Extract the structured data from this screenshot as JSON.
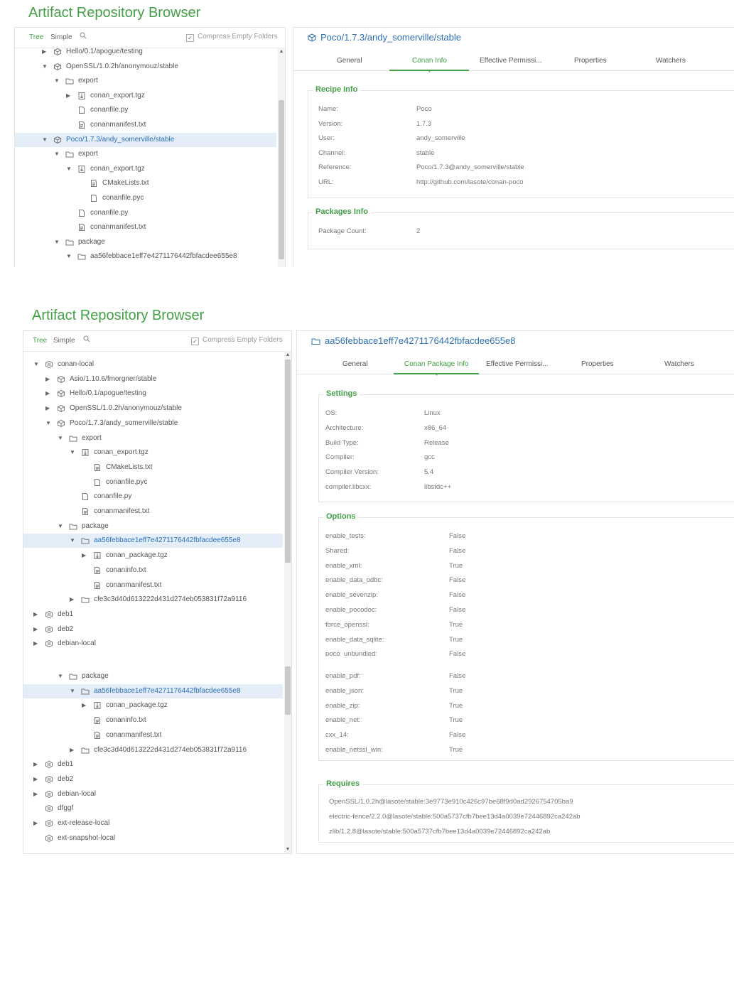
{
  "app_title": "Artifact Repository Browser",
  "tree_header": {
    "tree_tab": "Tree",
    "simple_tab": "Simple",
    "compress_label": "Compress Empty Folders"
  },
  "tabs_labels": [
    "General",
    "Conan Info",
    "Effective Permissi...",
    "Properties",
    "Watchers"
  ],
  "tabs_labels_pkg": [
    "General",
    "Conan Package Info",
    "Effective Permissi...",
    "Properties",
    "Watchers"
  ],
  "shot1": {
    "tree": [
      {
        "label": "Hello/0.1/apogue/testing",
        "icon": "package-icon",
        "indent": 0,
        "arrow": "right"
      },
      {
        "label": "OpenSSL/1.0.2h/anonymouz/stable",
        "icon": "package-icon",
        "indent": 0,
        "arrow": "down"
      },
      {
        "label": "export",
        "icon": "folder-icon",
        "indent": 1,
        "arrow": "down"
      },
      {
        "label": "conan_export.tgz",
        "icon": "archive-icon",
        "indent": 2,
        "arrow": "right"
      },
      {
        "label": "conanfile.py",
        "icon": "file-icon",
        "indent": 2,
        "arrow": ""
      },
      {
        "label": "conanmanifest.txt",
        "icon": "text-file-icon",
        "indent": 2,
        "arrow": ""
      },
      {
        "label": "Poco/1.7.3/andy_somerville/stable",
        "icon": "package-icon",
        "indent": 0,
        "arrow": "down",
        "selected": true
      },
      {
        "label": "export",
        "icon": "folder-icon",
        "indent": 1,
        "arrow": "down"
      },
      {
        "label": "conan_export.tgz",
        "icon": "archive-icon",
        "indent": 2,
        "arrow": "down"
      },
      {
        "label": "CMakeLists.txt",
        "icon": "text-file-icon",
        "indent": 3,
        "arrow": ""
      },
      {
        "label": "conanfile.pyc",
        "icon": "file-icon",
        "indent": 3,
        "arrow": ""
      },
      {
        "label": "conanfile.py",
        "icon": "file-icon",
        "indent": 2,
        "arrow": ""
      },
      {
        "label": "conanmanifest.txt",
        "icon": "text-file-icon",
        "indent": 2,
        "arrow": ""
      },
      {
        "label": "package",
        "icon": "folder-icon",
        "indent": 1,
        "arrow": "down"
      },
      {
        "label": "aa56febbace1eff7e4271176442fbfacdee655e8",
        "icon": "folder-icon",
        "indent": 2,
        "arrow": "down"
      }
    ],
    "right_title": "Poco/1.7.3/andy_somerville/stable",
    "recipe_title": "Recipe Info",
    "recipe": [
      {
        "key": "Name:",
        "value": "Poco"
      },
      {
        "key": "Version:",
        "value": "1.7.3"
      },
      {
        "key": "User:",
        "value": "andy_somerville"
      },
      {
        "key": "Channel:",
        "value": "stable"
      },
      {
        "key": "Reference:",
        "value": "Poco/1.7.3@andy_somerville/stable"
      },
      {
        "key": "URL:",
        "value": "http://github.com/lasote/conan-poco"
      }
    ],
    "packages_title": "Packages Info",
    "packages": [
      {
        "key": "Package Count:",
        "value": "2"
      }
    ]
  },
  "shot2": {
    "tree": [
      {
        "label": "conan-local",
        "icon": "repo-icon",
        "indent": 0,
        "arrow": "down"
      },
      {
        "label": "Asio/1.10.6/fmorgner/stable",
        "icon": "package-icon",
        "indent": 1,
        "arrow": "right"
      },
      {
        "label": "Hello/0.1/apogue/testing",
        "icon": "package-icon",
        "indent": 1,
        "arrow": "right"
      },
      {
        "label": "OpenSSL/1.0.2h/anonymouz/stable",
        "icon": "package-icon",
        "indent": 1,
        "arrow": "right"
      },
      {
        "label": "Poco/1.7.3/andy_somerville/stable",
        "icon": "package-icon",
        "indent": 1,
        "arrow": "down"
      },
      {
        "label": "export",
        "icon": "folder-icon",
        "indent": 2,
        "arrow": "down"
      },
      {
        "label": "conan_export.tgz",
        "icon": "archive-icon",
        "indent": 3,
        "arrow": "down"
      },
      {
        "label": "CMakeLists.txt",
        "icon": "text-file-icon",
        "indent": 4,
        "arrow": ""
      },
      {
        "label": "conanfile.pyc",
        "icon": "file-icon",
        "indent": 4,
        "arrow": ""
      },
      {
        "label": "conanfile.py",
        "icon": "file-icon",
        "indent": 3,
        "arrow": ""
      },
      {
        "label": "conanmanifest.txt",
        "icon": "text-file-icon",
        "indent": 3,
        "arrow": ""
      },
      {
        "label": "package",
        "icon": "folder-icon",
        "indent": 2,
        "arrow": "down"
      },
      {
        "label": "aa56febbace1eff7e4271176442fbfacdee655e8",
        "icon": "folder-icon",
        "indent": 3,
        "arrow": "down",
        "selected": true
      },
      {
        "label": "conan_package.tgz",
        "icon": "archive-icon",
        "indent": 4,
        "arrow": "right"
      },
      {
        "label": "conaninfo.txt",
        "icon": "text-file-icon",
        "indent": 4,
        "arrow": ""
      },
      {
        "label": "conanmanifest.txt",
        "icon": "text-file-icon",
        "indent": 4,
        "arrow": ""
      },
      {
        "label": "cfe3c3d40d613222d431d274eb053831f72a9116",
        "icon": "folder-icon",
        "indent": 3,
        "arrow": "right"
      },
      {
        "label": "deb1",
        "icon": "repo-icon",
        "indent": 0,
        "arrow": "right"
      },
      {
        "label": "deb2",
        "icon": "repo-icon",
        "indent": 0,
        "arrow": "right"
      },
      {
        "label": "debian-local",
        "icon": "repo-icon",
        "indent": 0,
        "arrow": "right"
      }
    ],
    "right_title": "aa56febbace1eff7e4271176442fbfacdee655e8",
    "settings_title": "Settings",
    "settings": [
      {
        "key": "OS:",
        "value": "Linux"
      },
      {
        "key": "Architecture:",
        "value": "x86_64"
      },
      {
        "key": "Build Type:",
        "value": "Release"
      },
      {
        "key": "Compiler:",
        "value": "gcc"
      },
      {
        "key": "Compiler Version:",
        "value": "5.4"
      },
      {
        "key": "compiler.libcxx:",
        "value": "libstdc++"
      }
    ],
    "options_title": "Options",
    "options": [
      {
        "key": "enable_tests:",
        "value": "False"
      },
      {
        "key": "Shared:",
        "value": "False"
      },
      {
        "key": "enable_xml:",
        "value": "True"
      },
      {
        "key": "enable_data_odbc:",
        "value": "False"
      },
      {
        "key": "enable_sevenzip:",
        "value": "False"
      },
      {
        "key": "enable_pocodoc:",
        "value": "False"
      },
      {
        "key": "force_openssl:",
        "value": "True"
      },
      {
        "key": "enable_data_sqlite:",
        "value": "True"
      },
      {
        "key": "poco_unbundled:",
        "value": "False"
      }
    ]
  },
  "shot3": {
    "tree": [
      {
        "label": "package",
        "icon": "folder-icon",
        "indent": 2,
        "arrow": "down"
      },
      {
        "label": "aa56febbace1eff7e4271176442fbfacdee655e8",
        "icon": "folder-icon",
        "indent": 3,
        "arrow": "down",
        "selected": true
      },
      {
        "label": "conan_package.tgz",
        "icon": "archive-icon",
        "indent": 4,
        "arrow": "right"
      },
      {
        "label": "conaninfo.txt",
        "icon": "text-file-icon",
        "indent": 4,
        "arrow": ""
      },
      {
        "label": "conanmanifest.txt",
        "icon": "text-file-icon",
        "indent": 4,
        "arrow": ""
      },
      {
        "label": "cfe3c3d40d613222d431d274eb053831f72a9116",
        "icon": "folder-icon",
        "indent": 3,
        "arrow": "right"
      },
      {
        "label": "deb1",
        "icon": "repo-icon",
        "indent": 0,
        "arrow": "right"
      },
      {
        "label": "deb2",
        "icon": "repo-icon",
        "indent": 0,
        "arrow": "right"
      },
      {
        "label": "debian-local",
        "icon": "repo-icon",
        "indent": 0,
        "arrow": "right"
      },
      {
        "label": "dfggf",
        "icon": "repo-icon",
        "indent": 0,
        "arrow": ""
      },
      {
        "label": "ext-release-local",
        "icon": "repo-icon",
        "indent": 0,
        "arrow": "right"
      },
      {
        "label": "ext-snapshot-local",
        "icon": "repo-icon",
        "indent": 0,
        "arrow": ""
      }
    ],
    "options_more": [
      {
        "key": "enable_pdf:",
        "value": "False"
      },
      {
        "key": "enable_json:",
        "value": "True"
      },
      {
        "key": "enable_zip:",
        "value": "True"
      },
      {
        "key": "enable_net:",
        "value": "True"
      },
      {
        "key": "cxx_14:",
        "value": "False"
      },
      {
        "key": "enable_netssl_win:",
        "value": "True"
      }
    ],
    "requires_title": "Requires",
    "requires": [
      "OpenSSL/1.0.2h@lasote/stable:3e9773e910c426c97be68f9d0ad2926754705ba9",
      "electric-fence/2.2.0@lasote/stable:500a5737cfb7bee13d4a0039e72446892ca242ab",
      "zlib/1.2.8@lasote/stable:500a5737cfb7bee13d4a0039e72446892ca242ab"
    ]
  }
}
